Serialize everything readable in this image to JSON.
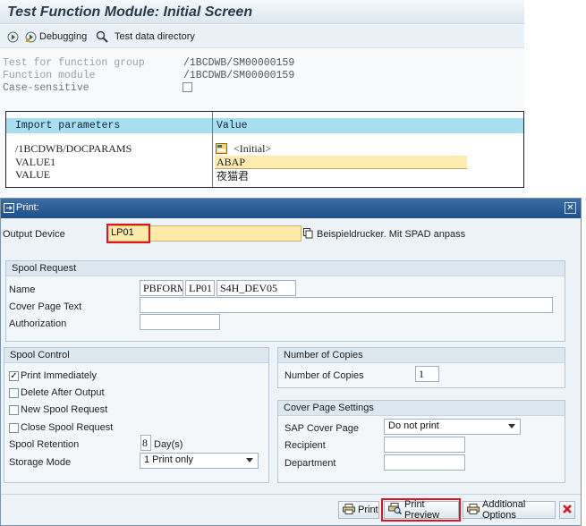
{
  "screen": {
    "title": "Test Function Module: Initial Screen",
    "toolbar": {
      "debugging_label": "Debugging",
      "test_data_label": "Test data directory"
    },
    "fields": {
      "group_label": "Test for function group",
      "group_value": "/1BCDWB/SM00000159",
      "module_label": "Function module",
      "module_value": "/1BCDWB/SM00000159",
      "case_label": "Case-sensitive"
    },
    "params": {
      "col_import": "Import parameters",
      "col_value": "Value",
      "rows": [
        {
          "name": "/1BCDWB/DOCPARAMS",
          "value": "<Initial>"
        },
        {
          "name": "VALUE1",
          "value": "ABAP"
        },
        {
          "name": "VALUE",
          "value": "夜猫君"
        }
      ]
    }
  },
  "dialog": {
    "title": "Print:",
    "output_device_label": "Output Device",
    "output_device_value": "LP01",
    "output_device_desc": "Beispieldrucker. Mit SPAD anpass",
    "spool_request": {
      "header": "Spool Request",
      "name_label": "Name",
      "name_parts": [
        "PBFORM",
        "LP01",
        "S4H_DEV05"
      ],
      "cover_text_label": "Cover Page Text",
      "cover_text_value": "",
      "authorization_label": "Authorization",
      "authorization_value": ""
    },
    "spool_control": {
      "header": "Spool Control",
      "print_immediately": "Print Immediately",
      "delete_after_output": "Delete After Output",
      "new_spool_request": "New Spool Request",
      "close_spool_request": "Close Spool Request",
      "retention_label": "Spool Retention",
      "retention_value": "8",
      "retention_unit": "Day(s)",
      "storage_label": "Storage Mode",
      "storage_value": "1 Print only",
      "checked": {
        "print_immediately": true,
        "delete_after_output": false,
        "new_spool_request": false,
        "close_spool_request": false
      }
    },
    "copies": {
      "header": "Number of Copies",
      "label": "Number of Copies",
      "value": "1"
    },
    "cover_page": {
      "header": "Cover Page Settings",
      "sap_cover_label": "SAP Cover Page",
      "sap_cover_value": "Do not print",
      "recipient_label": "Recipient",
      "recipient_value": "",
      "department_label": "Department",
      "department_value": ""
    },
    "buttons": {
      "print": "Print",
      "print_preview": "Print Preview",
      "additional_options": "Additional Options"
    },
    "highlight_color": "#e0141c"
  }
}
